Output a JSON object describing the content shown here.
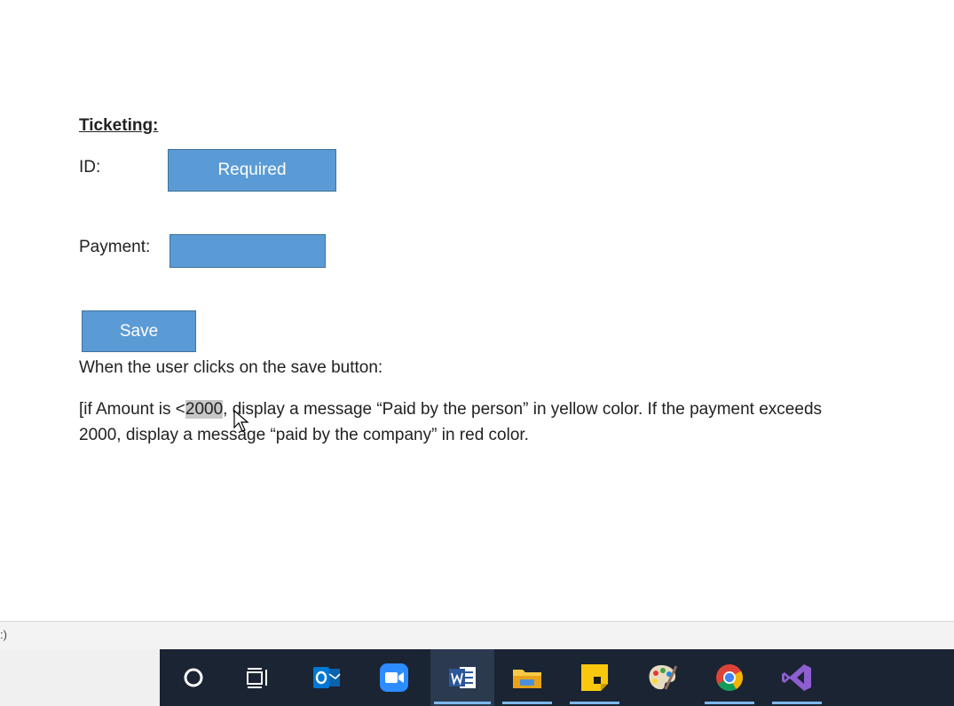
{
  "document": {
    "heading": "Ticketing:",
    "id_label": "ID:",
    "id_box_text": "Required",
    "payment_label": "Payment:",
    "payment_box_text": "",
    "save_label": "Save",
    "instruction": "When the user clicks on the save button:",
    "rule_line1_before": "[if Amount is <",
    "rule_line1_selected": "2000",
    "rule_line1_after": ", display a message “Paid by the person” in yellow color. If the payment exceeds",
    "rule_line2": "2000, display a message “paid by the company” in red color."
  },
  "statusbar": {
    "text": ":)"
  },
  "taskbar": {
    "items": [
      {
        "name": "cortana",
        "icon": "circle-icon"
      },
      {
        "name": "task-view",
        "icon": "task-view-icon"
      },
      {
        "name": "outlook",
        "icon": "outlook-icon"
      },
      {
        "name": "zoom",
        "icon": "zoom-icon"
      },
      {
        "name": "word",
        "icon": "word-icon",
        "active": true
      },
      {
        "name": "file-explorer",
        "icon": "folder-icon"
      },
      {
        "name": "sticky-notes",
        "icon": "sticky-notes-icon"
      },
      {
        "name": "paint",
        "icon": "paint-icon"
      },
      {
        "name": "chrome",
        "icon": "chrome-icon"
      },
      {
        "name": "visual-studio",
        "icon": "visual-studio-icon"
      }
    ]
  },
  "colors": {
    "box_fill": "#5b9bd5",
    "box_border": "#41719c",
    "taskbar_bg": "#1a2433",
    "selection": "#c7c7c7"
  }
}
